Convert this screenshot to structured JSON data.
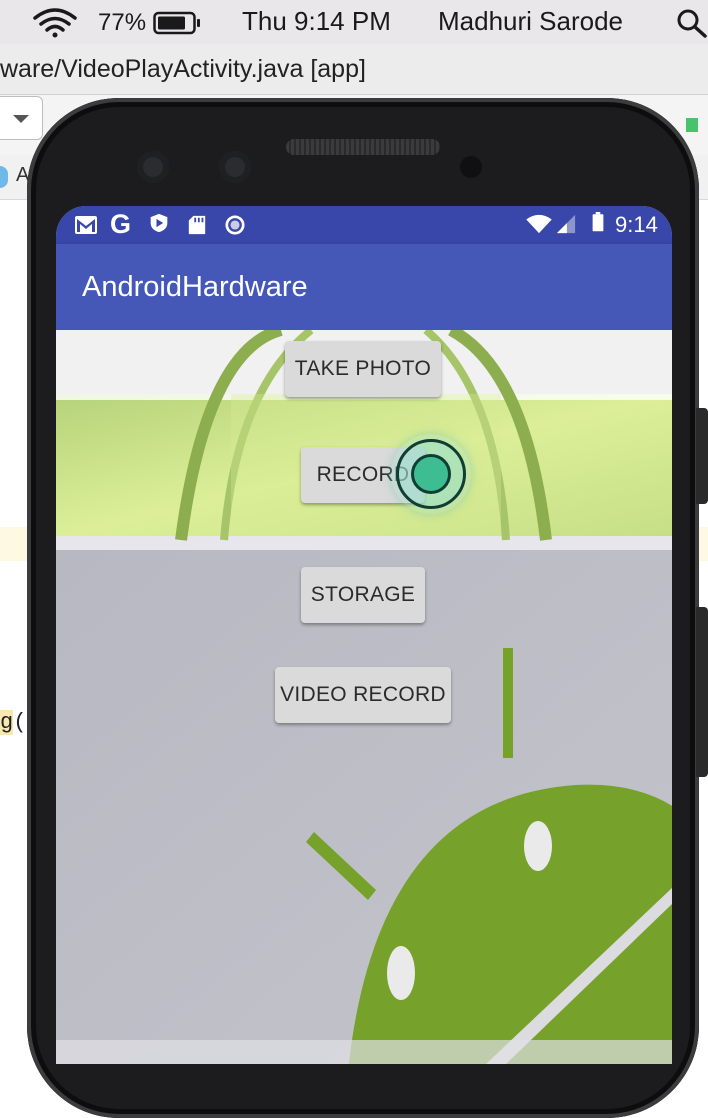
{
  "menubar": {
    "battery_percent": "77%",
    "clock": "Thu 9:14 PM",
    "user": "Madhuri Sarode",
    "icons": [
      "wifi-icon",
      "battery-icon",
      "spotlight-search-icon"
    ]
  },
  "ide": {
    "window_title": "ware/VideoPlayActivity.java [app]",
    "tab_label": "A",
    "code_fragment": "g(",
    "code_fragment_highlight": "g",
    "code_fragment_rest": "("
  },
  "phone": {
    "status_bar": {
      "time": "9:14",
      "g_label": "G",
      "left_icons": [
        "gmail-icon",
        "google-icon",
        "play-protect-icon",
        "sd-card-icon",
        "record-circle-icon"
      ],
      "right_icons": [
        "wifi-icon",
        "cellular-signal-icon",
        "battery-icon"
      ]
    },
    "app_bar": {
      "title": "AndroidHardware"
    },
    "buttons": {
      "take_photo": "TAKE PHOTO",
      "record": "RECORD",
      "storage": "STORAGE",
      "video_record": "VIDEO RECORD"
    },
    "colors": {
      "status_bar": "#3847a9",
      "app_bar": "#4558b8",
      "android_green": "#76a12a"
    }
  }
}
